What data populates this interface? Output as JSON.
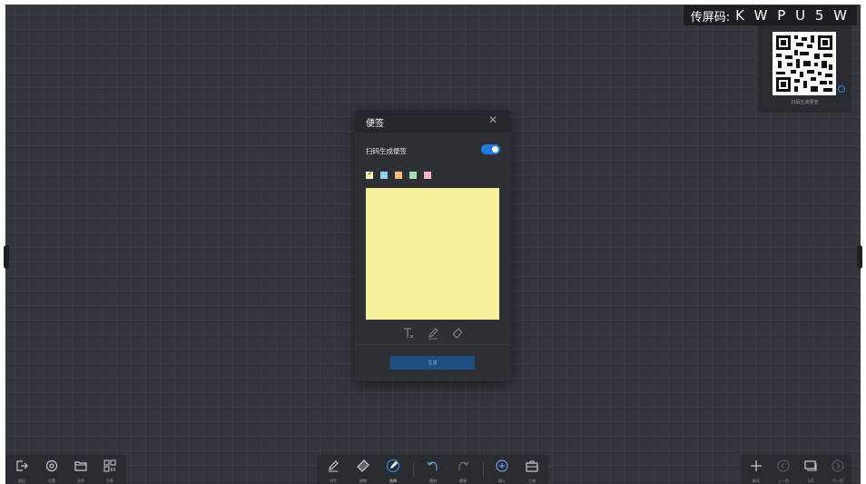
{
  "screen_code": {
    "label": "传屏码:",
    "value": "K W P U 5 W"
  },
  "qr_panel": {
    "caption": "扫码生成便签"
  },
  "dialog": {
    "title": "便签",
    "close_icon": "close-icon",
    "scan_label": "扫码生成便签",
    "toggle_on": true,
    "colors": [
      "#f5ee9c",
      "#8fd3f0",
      "#f5b97a",
      "#9fe0b0",
      "#f4b6c2"
    ],
    "selected_color": "#f5ee9c",
    "tools": [
      "text-format-icon",
      "pen-icon",
      "eraser-icon"
    ],
    "generate_button": "生成"
  },
  "toolbar_left": [
    {
      "icon": "exit-icon",
      "label": "退出"
    },
    {
      "icon": "settings-icon",
      "label": "设置"
    },
    {
      "icon": "folder-icon",
      "label": "文件"
    },
    {
      "icon": "share-icon",
      "label": "分享"
    }
  ],
  "toolbar_center": [
    {
      "icon": "pen-icon",
      "label": "书写"
    },
    {
      "icon": "eraser-icon",
      "label": "擦除"
    },
    {
      "icon": "select-icon",
      "label": "选择",
      "active": true
    },
    {
      "icon": "undo-icon",
      "label": "撤销"
    },
    {
      "icon": "redo-icon",
      "label": "重做"
    },
    {
      "icon": "insert-icon",
      "label": "插入"
    },
    {
      "icon": "toolbox-icon",
      "label": "工具"
    }
  ],
  "toolbar_right": [
    {
      "icon": "add-page-icon",
      "label": "新页"
    },
    {
      "icon": "prev-page-icon",
      "label": "上一页"
    },
    {
      "icon": "pages-icon",
      "label": "1/1"
    },
    {
      "icon": "next-page-icon",
      "label": "下一页"
    }
  ]
}
